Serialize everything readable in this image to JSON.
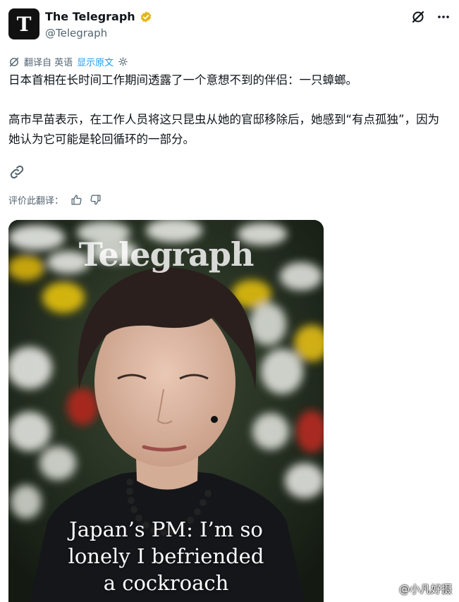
{
  "author": {
    "display_name": "The Telegraph",
    "handle": "@Telegraph",
    "avatar_glyph": "T",
    "verified_color": "#e2b719"
  },
  "icons": {
    "verified": "verified-badge-icon",
    "grok": "grok-icon",
    "more": "more-icon",
    "translate": "translate-icon",
    "settings": "settings-icon",
    "link": "link-icon",
    "thumbs_up": "thumbs-up-icon",
    "thumbs_down": "thumbs-down-icon"
  },
  "translation": {
    "label": "翻译自 英语",
    "show_original": "显示原文"
  },
  "post": {
    "paragraph1": "日本首相在长时间工作期间透露了一个意想不到的伴侣：一只蟑螂。",
    "paragraph2": "高市早苗表示，在工作人员将这只昆虫从她的官邸移除后，她感到“有点孤独”，因为她认为它可能是轮回循环的一部分。"
  },
  "rating": {
    "label": "评价此翻译："
  },
  "media": {
    "brand": "Telegraph",
    "headline_line1": "Japan’s PM: I’m so",
    "headline_line2": "lonely I befriended",
    "headline_line3": "a cockroach"
  },
  "watermark": {
    "text": "@小凡好摄"
  },
  "colors": {
    "accent_blue": "#1d9bf0",
    "muted": "#536471",
    "text": "#0f1419"
  }
}
